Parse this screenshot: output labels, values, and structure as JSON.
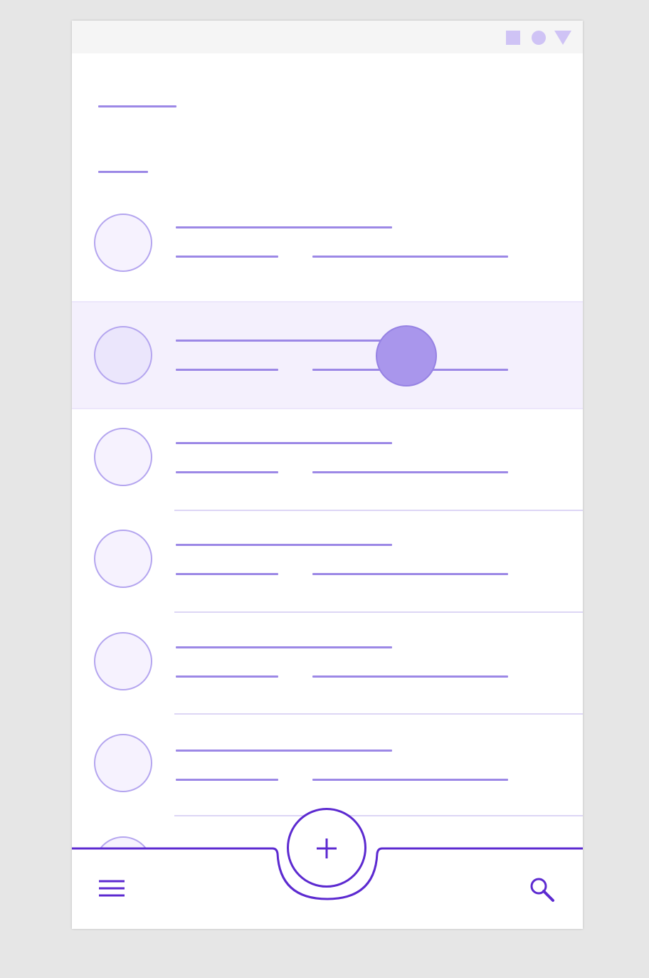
{
  "app": {
    "colors": {
      "accent": "#5c2ad0",
      "placeholder_line": "#9c88e6",
      "avatar_border": "#b4a5ef",
      "selected_row": "#f4f0fd",
      "status_icons": "#cfc3f5"
    }
  },
  "status_bar": {
    "icons": [
      "square-icon",
      "circle-icon",
      "triangle-icon"
    ]
  },
  "list": {
    "rows": 6,
    "selected_row_index": 1
  },
  "bottom_bar": {
    "menu_icon": "menu-icon",
    "fab_icon": "plus-icon",
    "search_icon": "search-icon"
  }
}
